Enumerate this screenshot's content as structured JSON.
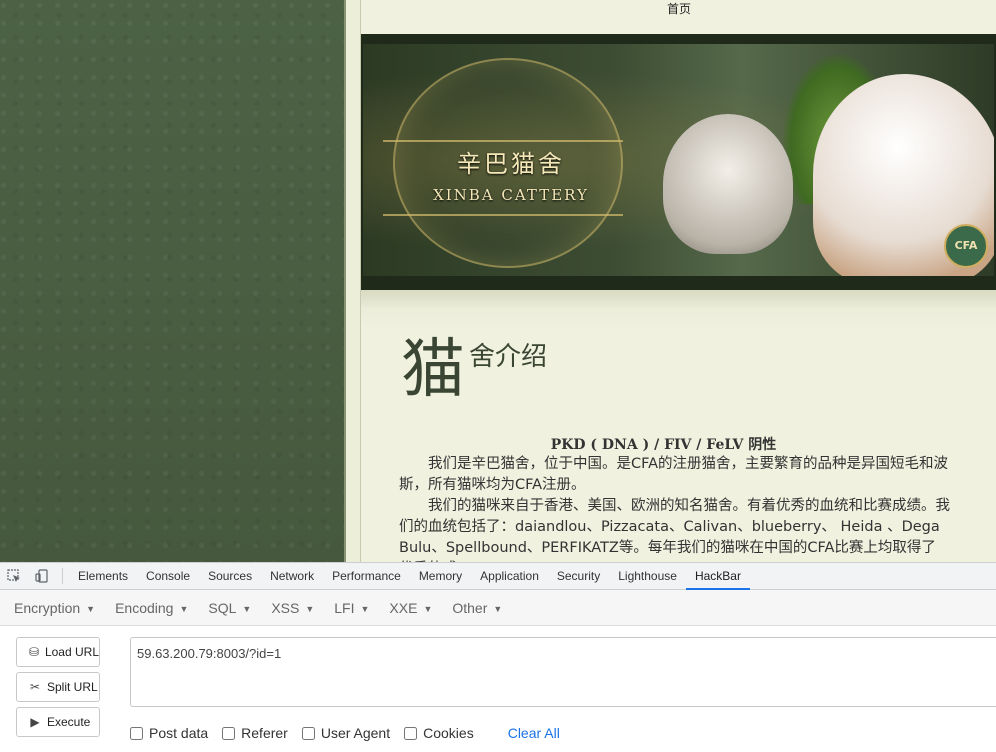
{
  "site": {
    "nav_home": "首页",
    "banner_title_cn": "辛巴猫舍",
    "banner_title_en": "XINBA CATTERY",
    "badge_text": "CFA",
    "heading_big": "猫",
    "heading_small": "舍介绍",
    "pkd_line": "PKD ( DNA ) / FIV / FeLV 阴性",
    "paragraph_1": "我们是辛巴猫舍，位于中国。是CFA的注册猫舍，主要繁育的品种是异国短毛和波斯，所有猫咪均为CFA注册。",
    "paragraph_2": "我们的猫咪来自于香港、美国、欧洲的知名猫舍。有着优秀的血统和比赛成绩。我们的血统包括了：daiandlou、Pizzacata、Calivan、blueberry、 Heida 、Dega Bulu、Spellbound、PERFIKATZ等。每年我们的猫咪在中国的CFA比赛上均取得了优秀的成"
  },
  "devtools": {
    "tabs": [
      "Elements",
      "Console",
      "Sources",
      "Network",
      "Performance",
      "Memory",
      "Application",
      "Security",
      "Lighthouse",
      "HackBar"
    ],
    "active_tab": "HackBar",
    "icons": {
      "inspect": "inspect-element-icon",
      "device": "device-toolbar-icon"
    }
  },
  "hackbar": {
    "menus": [
      "Encryption",
      "Encoding",
      "SQL",
      "XSS",
      "LFI",
      "XXE",
      "Other"
    ],
    "load_url": "Load URL",
    "split_url": "Split URL",
    "execute": "Execute",
    "url_value": "59.63.200.79:8003/?id=1",
    "options": {
      "post_data": "Post data",
      "referer": "Referer",
      "user_agent": "User Agent",
      "cookies": "Cookies"
    },
    "clear_all": "Clear All",
    "link_color": "#1a73e8"
  }
}
